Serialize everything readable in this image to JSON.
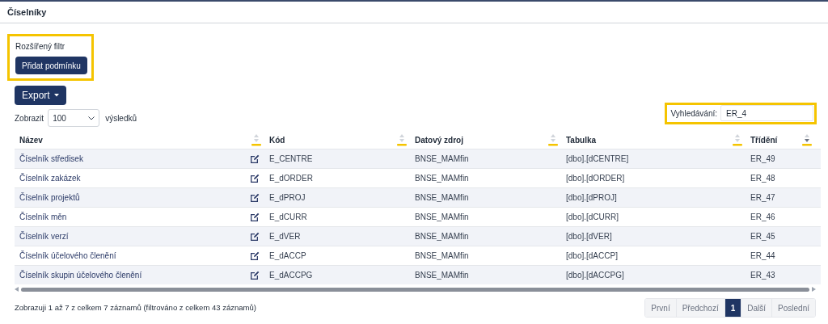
{
  "page": {
    "title": "Číselníky"
  },
  "filter": {
    "label": "Rozšířený filtr",
    "button": "Přidat podmínku",
    "highlighted": true
  },
  "export_button": "Export",
  "length": {
    "label_before": "Zobrazit",
    "value": "100",
    "label_after": "výsledků"
  },
  "search": {
    "label": "Vyhledávání:",
    "value": "ER_4",
    "highlighted": true
  },
  "table": {
    "columns": [
      {
        "label": "Název",
        "sorted_descending": false
      },
      {
        "label": "Kód",
        "sorted_descending": false
      },
      {
        "label": "Datový zdroj",
        "sorted_descending": false
      },
      {
        "label": "Tabulka",
        "sorted_descending": false
      },
      {
        "label": "Třídění",
        "sorted_descending": true
      }
    ],
    "rows": [
      [
        "Číselník středisek",
        "E_CENTRE",
        "BNSE_MAMfin",
        "[dbo].[dCENTRE]",
        "ER_49"
      ],
      [
        "Číselník zakázek",
        "E_dORDER",
        "BNSE_MAMfin",
        "[dbo].[dORDER]",
        "ER_48"
      ],
      [
        "Číselník projektů",
        "E_dPROJ",
        "BNSE_MAMfin",
        "[dbo].[dPROJ]",
        "ER_47"
      ],
      [
        "Číselník měn",
        "E_dCURR",
        "BNSE_MAMfin",
        "[dbo].[dCURR]",
        "ER_46"
      ],
      [
        "Číselník verzí",
        "E_dVER",
        "BNSE_MAMfin",
        "[dbo].[dVER]",
        "ER_45"
      ],
      [
        "Číselník účelového členění",
        "E_dACCP",
        "BNSE_MAMfin",
        "[dbo].[dACCP]",
        "ER_44"
      ],
      [
        "Číselník skupin účelového členění",
        "E_dACCPG",
        "BNSE_MAMfin",
        "[dbo].[dACCPG]",
        "ER_43"
      ]
    ]
  },
  "info": "Zobrazuji 1 až 7 z celkem 7 záznamů (filtrováno z celkem 43 záznamů)",
  "pagination": [
    {
      "label": "První",
      "selected": false
    },
    {
      "label": "Předchozí",
      "selected": false
    },
    {
      "label": "1",
      "selected": true
    },
    {
      "label": "Další",
      "selected": false
    },
    {
      "label": "Poslední",
      "selected": false
    }
  ]
}
